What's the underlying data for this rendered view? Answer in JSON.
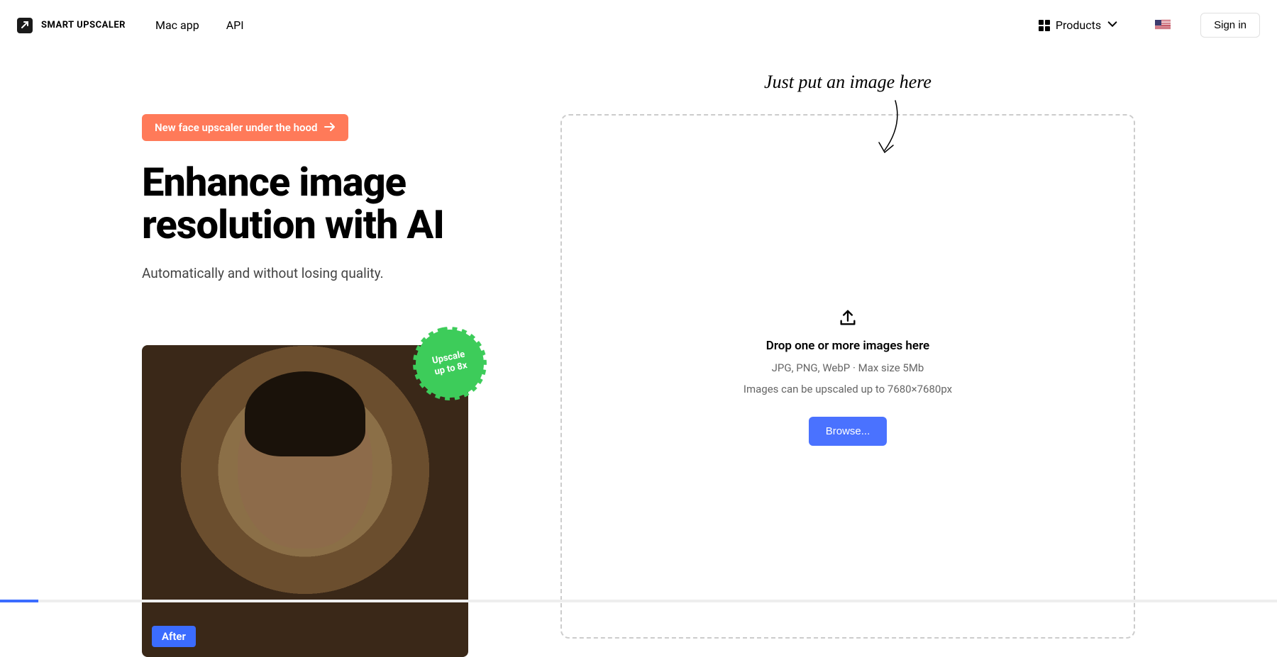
{
  "header": {
    "brand": "SMART UPSCALER",
    "nav": {
      "mac": "Mac app",
      "api": "API"
    },
    "products": "Products",
    "signin": "Sign in"
  },
  "hero": {
    "badge": "New face upscaler under the hood",
    "headline": "Enhance image resolution with AI",
    "sub": "Automatically and without losing quality.",
    "sticker_line1": "Upscale",
    "sticker_line2": "up to 8x",
    "after": "After"
  },
  "dropzone": {
    "hint": "Just put an image here",
    "title": "Drop one or more images here",
    "formats": "JPG, PNG, WebP · Max size 5Mb",
    "limits": "Images can be upscaled up to 7680×7680px",
    "browse": "Browse..."
  }
}
